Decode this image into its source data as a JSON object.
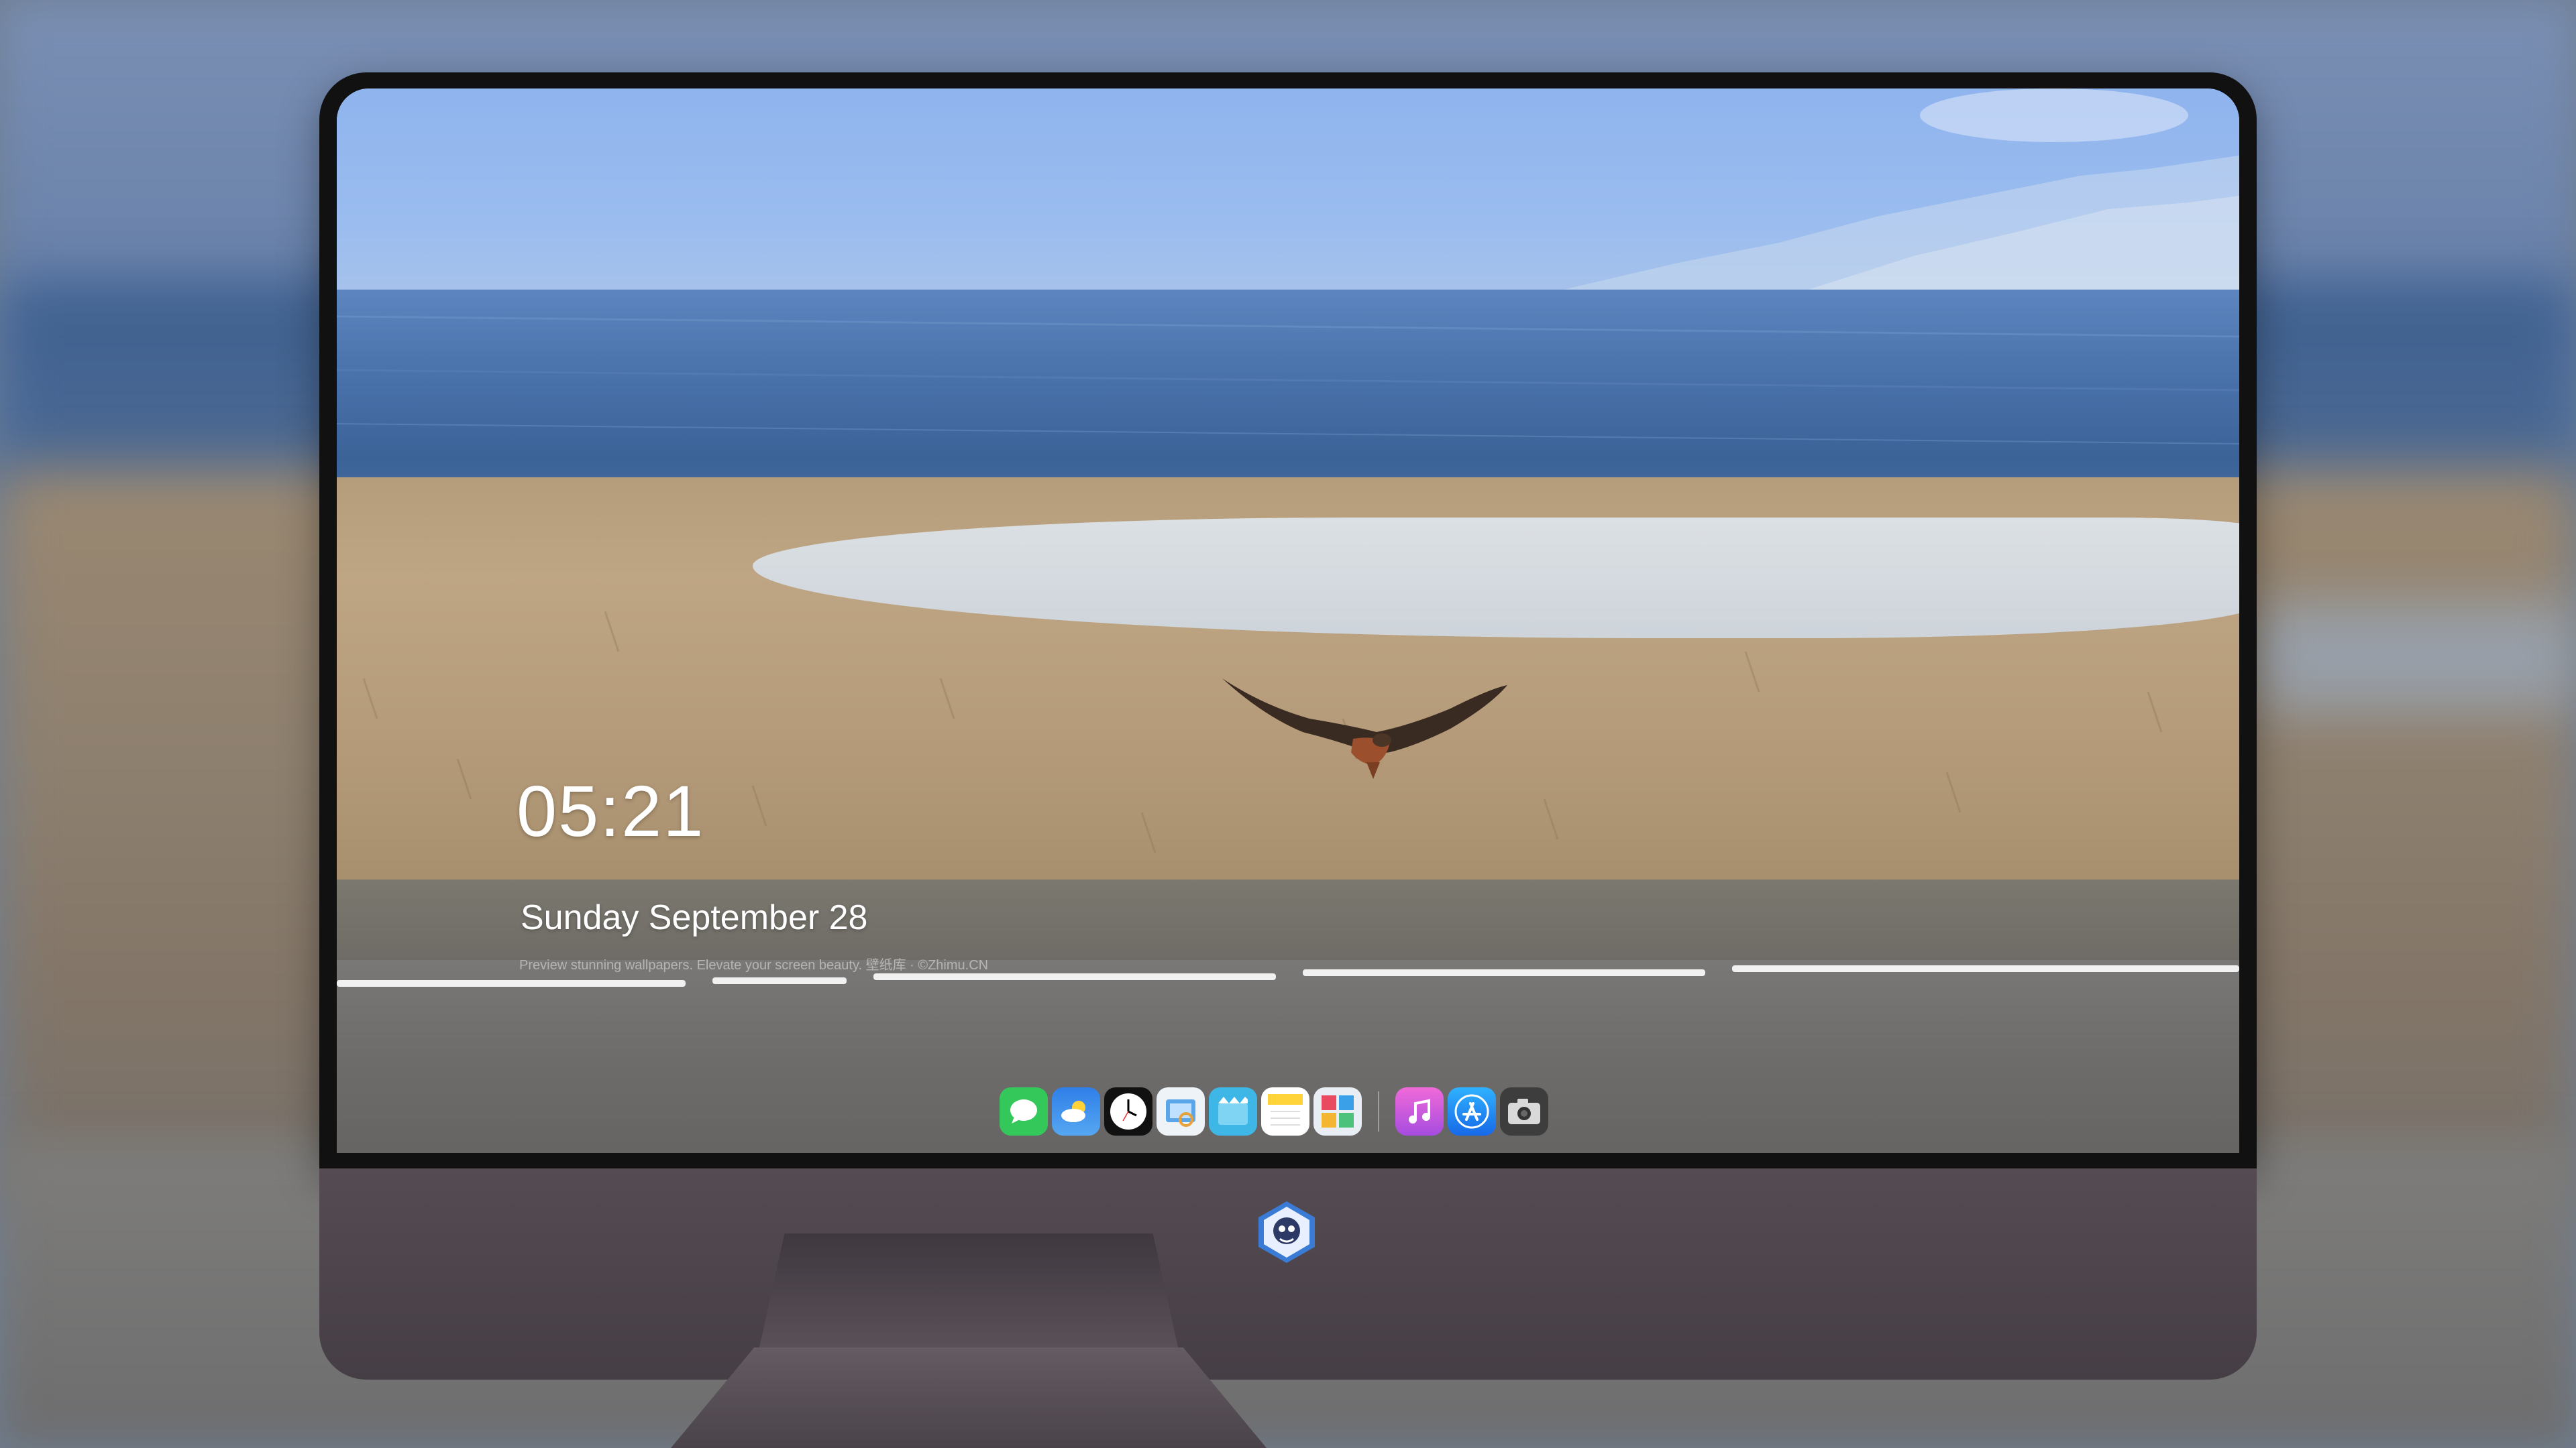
{
  "lockscreen": {
    "time": "05:21",
    "date": "Sunday September  28",
    "credit": "Preview stunning wallpapers. Elevate your screen beauty. 壁纸库 · ©Zhimu.CN"
  },
  "dock": {
    "apps": [
      {
        "name": "Messages",
        "icon": "messages-icon",
        "color": "#34c759"
      },
      {
        "name": "Weather",
        "icon": "weather-icon",
        "color": "#3a8ef0"
      },
      {
        "name": "Clock",
        "icon": "clock-icon",
        "color": "#111111"
      },
      {
        "name": "Preview",
        "icon": "preview-icon",
        "color": "#5aa6e8"
      },
      {
        "name": "Clips",
        "icon": "clips-icon",
        "color": "#3fb7e6"
      },
      {
        "name": "Notes",
        "icon": "notes-icon",
        "color": "#ffd43a"
      },
      {
        "name": "Photo Booth",
        "icon": "photobooth-icon",
        "color": "#e9eef5"
      },
      {
        "name": "iTunes",
        "icon": "itunes-icon",
        "color": "#d64fd0"
      },
      {
        "name": "App Store",
        "icon": "appstore-icon",
        "color": "#2b8cf5"
      },
      {
        "name": "Camera",
        "icon": "camera-icon",
        "color": "#4a4a4a"
      }
    ]
  },
  "colors": {
    "bezel": "#111111",
    "chin": "#4e454c",
    "sky": "#8fb4ee",
    "sea": "#4a72aa",
    "field": "#b49a78"
  }
}
